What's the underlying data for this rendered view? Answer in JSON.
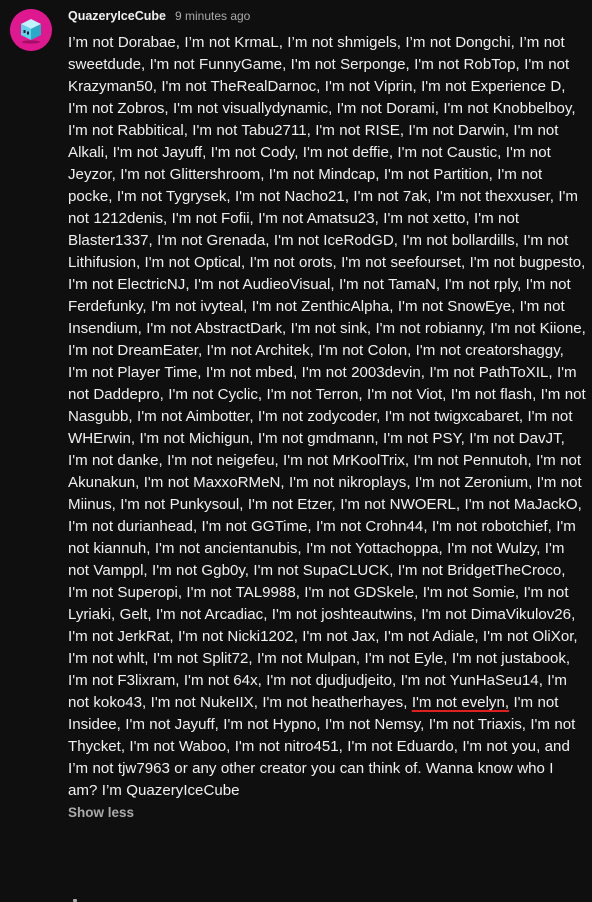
{
  "comment": {
    "author": "QuazeryIceCube",
    "timestamp": "9 minutes ago",
    "avatar_icon": "ice-cube-icon",
    "text_before": "I’m not Dorabae, I’m not KrmaL, I’m not shmigels, I’m not Dongchi, I’m not sweetdude, I'm not FunnyGame, I'm not Serponge, I'm not RobTop, I'm not Krazyman50, I'm not TheRealDarnoc, I'm not Viprin, I'm not Experience D, I'm not Zobros, I'm not visuallydynamic, I'm not Dorami, I'm not Knobbelboy, I'm not Rabbitical, I'm not Tabu2711, I'm not RISE, I'm not Darwin, I'm not Alkali, I'm not Jayuff, I'm not Cody, I'm not deffie, I'm not Caustic, I'm not Jeyzor, I'm not Glittershroom, I'm not Mindcap, I'm not Partition, I'm not pocke, I'm not Tygrysek, I'm not Nacho21, I'm not 7ak, I'm not thexxuser, I'm not 1212denis, I'm not Fofii, I'm not Amatsu23, I'm not xetto, I'm not Blaster1337, I'm not Grenada, I'm not IceRodGD, I'm not bollardills, I'm not Lithifusion, I'm not Optical, I'm not orots, I'm not seefourset, I'm not bugpesto, I'm not ElectricNJ, I'm not AudieoVisual, I'm not TamaN, I'm not rply, I'm not Ferdefunky, I'm not ivyteal, I'm not ZenthicAlpha, I'm not SnowEye, I'm not Insendium, I'm not AbstractDark, I'm not sink, I'm not robianny, I'm not Kiione, I'm not DreamEater, I'm not Architek, I'm not Colon, I'm not creatorshaggy, I'm not Player Time, I'm not mbed, I'm not 2003devin, I'm not PathToXIL, I'm not Daddepro, I'm not Cyclic, I'm not Terron, I'm not Viot, I'm not flash, I'm not Nasgubb, I'm not Aimbotter, I'm not zodycoder, I'm not twigxcabaret, I'm not WHErwin, I'm not Michigun, I'm not gmdmann, I'm not PSY, I'm not DavJT, I'm not danke, I'm not neigefeu, I'm not MrKoolTrix, I'm not Pennutoh, I'm not Akunakun, I'm not MaxxoRMeN, I'm not nikroplays, I'm not Zeronium, I'm not Miinus, I'm not Punkysoul, I'm not Etzer, I'm not NWOERL, I'm not MaJackO, I'm not durianhead, I'm not GGTime, I'm not Crohn44, I'm not robotchief, I'm not kiannuh, I'm not ancientanubis, I'm not Yottachoppa, I'm not Wulzy, I'm not Vamppl, I'm not Ggb0y, I'm not SupaCLUCK, I'm not BridgetTheCroco, I'm not Superopi, I'm not TAL9988, I'm not GDSkele, I'm not Somie, I'm not Lyriaki, Gelt, I'm not Arcadiac, I'm not joshteautwins, I'm not DimaVikulov26, I'm not JerkRat, I'm not Nicki1202, I'm not Jax, I'm not Adiale, I'm not OliXor, I'm not whlt, I'm not Split72, I'm not Mulpan, I'm not Eyle, I'm not justabook, I'm not F3lixram, I'm not 64x, I'm not djudjudjeito, I'm not YunHaSeu14, I'm not koko43, I'm not NukeIIX, I'm not heatherhayes, ",
    "text_highlight": "I'm not evelyn,",
    "text_after": " I'm not Insidee, I'm not Jayuff, I'm not Hypno, I'm not Nemsy, I'm not Triaxis, I'm not Thycket, I'm not Waboo, I'm not nitro451, I'm not Eduardo, I'm not you, and I’m not tjw7963 or any other creator you can think of. Wanna know who I am? I’m QuazeryIceCube",
    "show_less_label": "Show less",
    "colors": {
      "background": "#0f0f0f",
      "text": "#f1f1f1",
      "secondary": "#aaaaaa",
      "avatar_bg": "#e0188f",
      "underline": "#e02020"
    }
  }
}
